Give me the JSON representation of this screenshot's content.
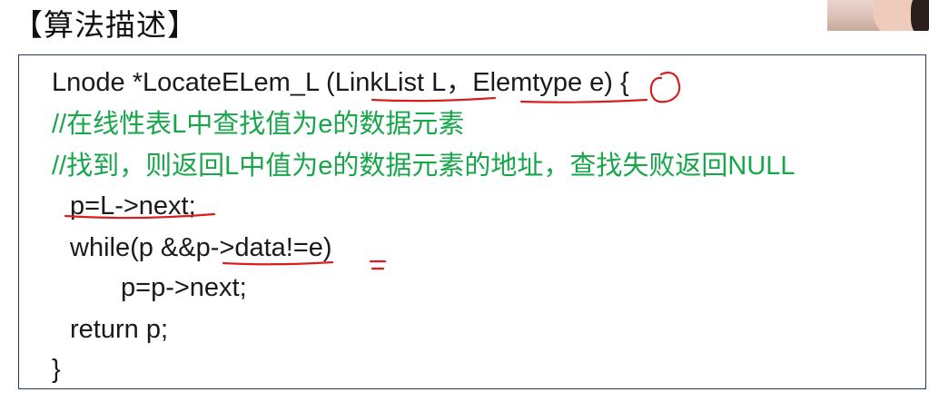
{
  "section_title": "【算法描述】",
  "code": {
    "line1": "Lnode *LocateELem_L (LinkList L，Elemtype e) {",
    "line2": "//在线性表L中查找值为e的数据元素",
    "line3": "//找到，则返回L中值为e的数据元素的地址，查找失败返回NULL",
    "line4": "p=L->next;",
    "line5": "while(p &&p->data!=e)",
    "line6": "p=p->next;",
    "line7": "return p;",
    "line8": "}"
  },
  "colors": {
    "code_text": "#1a1a1a",
    "comment_text": "#17a64a",
    "annotation_ink": "#d81e1e",
    "box_border": "#243a5e"
  }
}
